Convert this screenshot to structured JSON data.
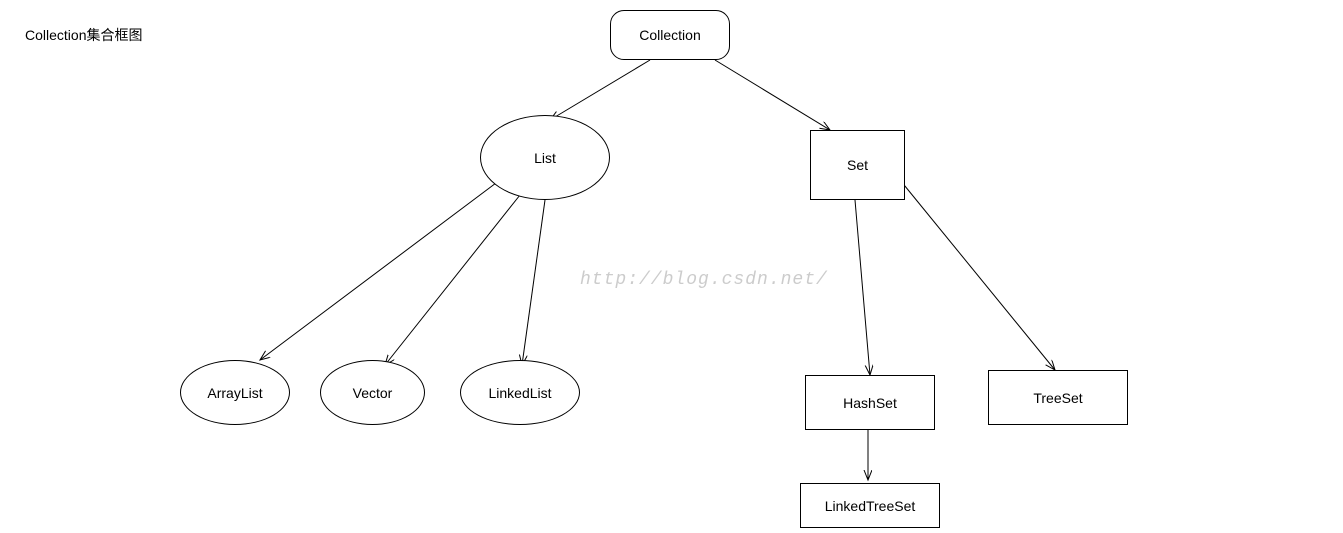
{
  "title": "Collection集合框图",
  "watermark": "http://blog.csdn.net/",
  "nodes": {
    "collection": "Collection",
    "list": "List",
    "set": "Set",
    "arraylist": "ArrayList",
    "vector": "Vector",
    "linkedlist": "LinkedList",
    "hashset": "HashSet",
    "treeset": "TreeSet",
    "linkedtreeset": "LinkedTreeSet"
  },
  "chart_data": {
    "type": "hierarchy",
    "title": "Collection集合框图",
    "root": "Collection",
    "edges": [
      {
        "from": "Collection",
        "to": "List"
      },
      {
        "from": "Collection",
        "to": "Set"
      },
      {
        "from": "List",
        "to": "ArrayList"
      },
      {
        "from": "List",
        "to": "Vector"
      },
      {
        "from": "List",
        "to": "LinkedList"
      },
      {
        "from": "Set",
        "to": "HashSet"
      },
      {
        "from": "Set",
        "to": "TreeSet"
      },
      {
        "from": "HashSet",
        "to": "LinkedTreeSet"
      }
    ],
    "node_shapes": {
      "Collection": "rounded-rect",
      "List": "ellipse",
      "Set": "rect",
      "ArrayList": "ellipse",
      "Vector": "ellipse",
      "LinkedList": "ellipse",
      "HashSet": "rect",
      "TreeSet": "rect",
      "LinkedTreeSet": "rect"
    }
  }
}
